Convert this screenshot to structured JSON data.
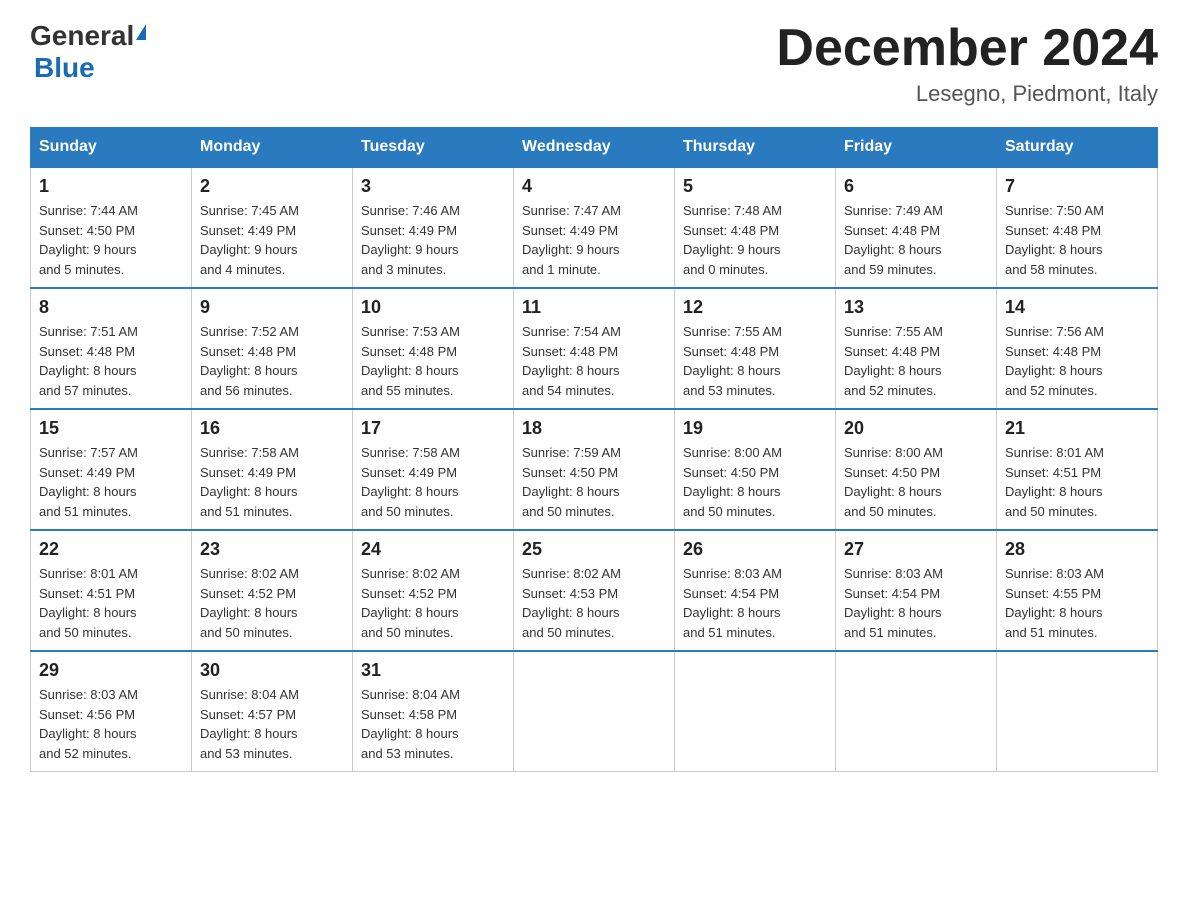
{
  "logo": {
    "general": "General",
    "blue_text": "Blue",
    "triangle": "▶"
  },
  "title": "December 2024",
  "location": "Lesegno, Piedmont, Italy",
  "days_of_week": [
    "Sunday",
    "Monday",
    "Tuesday",
    "Wednesday",
    "Thursday",
    "Friday",
    "Saturday"
  ],
  "weeks": [
    [
      {
        "day": "1",
        "info": "Sunrise: 7:44 AM\nSunset: 4:50 PM\nDaylight: 9 hours\nand 5 minutes."
      },
      {
        "day": "2",
        "info": "Sunrise: 7:45 AM\nSunset: 4:49 PM\nDaylight: 9 hours\nand 4 minutes."
      },
      {
        "day": "3",
        "info": "Sunrise: 7:46 AM\nSunset: 4:49 PM\nDaylight: 9 hours\nand 3 minutes."
      },
      {
        "day": "4",
        "info": "Sunrise: 7:47 AM\nSunset: 4:49 PM\nDaylight: 9 hours\nand 1 minute."
      },
      {
        "day": "5",
        "info": "Sunrise: 7:48 AM\nSunset: 4:48 PM\nDaylight: 9 hours\nand 0 minutes."
      },
      {
        "day": "6",
        "info": "Sunrise: 7:49 AM\nSunset: 4:48 PM\nDaylight: 8 hours\nand 59 minutes."
      },
      {
        "day": "7",
        "info": "Sunrise: 7:50 AM\nSunset: 4:48 PM\nDaylight: 8 hours\nand 58 minutes."
      }
    ],
    [
      {
        "day": "8",
        "info": "Sunrise: 7:51 AM\nSunset: 4:48 PM\nDaylight: 8 hours\nand 57 minutes."
      },
      {
        "day": "9",
        "info": "Sunrise: 7:52 AM\nSunset: 4:48 PM\nDaylight: 8 hours\nand 56 minutes."
      },
      {
        "day": "10",
        "info": "Sunrise: 7:53 AM\nSunset: 4:48 PM\nDaylight: 8 hours\nand 55 minutes."
      },
      {
        "day": "11",
        "info": "Sunrise: 7:54 AM\nSunset: 4:48 PM\nDaylight: 8 hours\nand 54 minutes."
      },
      {
        "day": "12",
        "info": "Sunrise: 7:55 AM\nSunset: 4:48 PM\nDaylight: 8 hours\nand 53 minutes."
      },
      {
        "day": "13",
        "info": "Sunrise: 7:55 AM\nSunset: 4:48 PM\nDaylight: 8 hours\nand 52 minutes."
      },
      {
        "day": "14",
        "info": "Sunrise: 7:56 AM\nSunset: 4:48 PM\nDaylight: 8 hours\nand 52 minutes."
      }
    ],
    [
      {
        "day": "15",
        "info": "Sunrise: 7:57 AM\nSunset: 4:49 PM\nDaylight: 8 hours\nand 51 minutes."
      },
      {
        "day": "16",
        "info": "Sunrise: 7:58 AM\nSunset: 4:49 PM\nDaylight: 8 hours\nand 51 minutes."
      },
      {
        "day": "17",
        "info": "Sunrise: 7:58 AM\nSunset: 4:49 PM\nDaylight: 8 hours\nand 50 minutes."
      },
      {
        "day": "18",
        "info": "Sunrise: 7:59 AM\nSunset: 4:50 PM\nDaylight: 8 hours\nand 50 minutes."
      },
      {
        "day": "19",
        "info": "Sunrise: 8:00 AM\nSunset: 4:50 PM\nDaylight: 8 hours\nand 50 minutes."
      },
      {
        "day": "20",
        "info": "Sunrise: 8:00 AM\nSunset: 4:50 PM\nDaylight: 8 hours\nand 50 minutes."
      },
      {
        "day": "21",
        "info": "Sunrise: 8:01 AM\nSunset: 4:51 PM\nDaylight: 8 hours\nand 50 minutes."
      }
    ],
    [
      {
        "day": "22",
        "info": "Sunrise: 8:01 AM\nSunset: 4:51 PM\nDaylight: 8 hours\nand 50 minutes."
      },
      {
        "day": "23",
        "info": "Sunrise: 8:02 AM\nSunset: 4:52 PM\nDaylight: 8 hours\nand 50 minutes."
      },
      {
        "day": "24",
        "info": "Sunrise: 8:02 AM\nSunset: 4:52 PM\nDaylight: 8 hours\nand 50 minutes."
      },
      {
        "day": "25",
        "info": "Sunrise: 8:02 AM\nSunset: 4:53 PM\nDaylight: 8 hours\nand 50 minutes."
      },
      {
        "day": "26",
        "info": "Sunrise: 8:03 AM\nSunset: 4:54 PM\nDaylight: 8 hours\nand 51 minutes."
      },
      {
        "day": "27",
        "info": "Sunrise: 8:03 AM\nSunset: 4:54 PM\nDaylight: 8 hours\nand 51 minutes."
      },
      {
        "day": "28",
        "info": "Sunrise: 8:03 AM\nSunset: 4:55 PM\nDaylight: 8 hours\nand 51 minutes."
      }
    ],
    [
      {
        "day": "29",
        "info": "Sunrise: 8:03 AM\nSunset: 4:56 PM\nDaylight: 8 hours\nand 52 minutes."
      },
      {
        "day": "30",
        "info": "Sunrise: 8:04 AM\nSunset: 4:57 PM\nDaylight: 8 hours\nand 53 minutes."
      },
      {
        "day": "31",
        "info": "Sunrise: 8:04 AM\nSunset: 4:58 PM\nDaylight: 8 hours\nand 53 minutes."
      },
      {
        "day": "",
        "info": ""
      },
      {
        "day": "",
        "info": ""
      },
      {
        "day": "",
        "info": ""
      },
      {
        "day": "",
        "info": ""
      }
    ]
  ]
}
